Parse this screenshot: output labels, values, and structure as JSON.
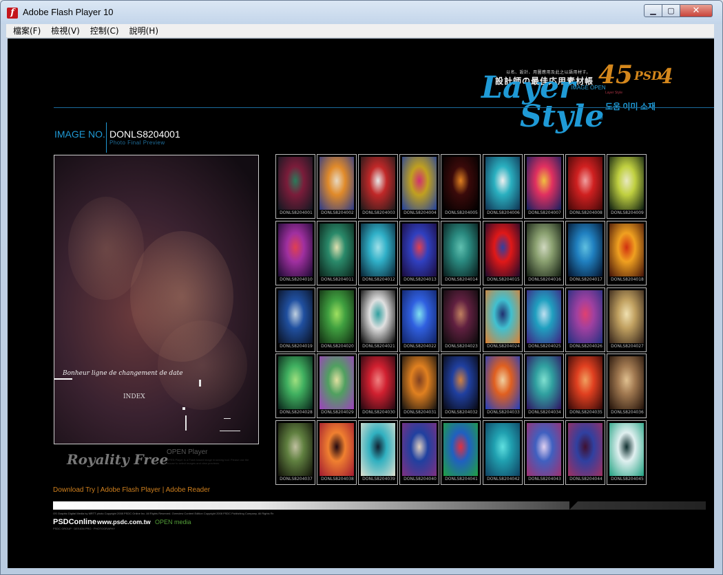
{
  "window": {
    "title": "Adobe Flash Player 10"
  },
  "window_controls": {
    "minimize": "▁",
    "maximize": "▢",
    "close": "✕"
  },
  "menu": [
    {
      "label": "檔案(F)"
    },
    {
      "label": "檢視(V)"
    },
    {
      "label": "控制(C)"
    },
    {
      "label": "說明(H)"
    }
  ],
  "logo": {
    "small_text": "以名、設計、用圖應用及此之以語用材す。",
    "cn_title": "設計師の最佳応用素材帳",
    "number": "45",
    "psd": "PSD",
    "version": "4",
    "image_open": "IMAGE OPEN",
    "word1": "Layer",
    "word2": "Style",
    "tm": "TM",
    "korean": "도움 이미 소재",
    "tiny": "Layer Style",
    "accent_color": "#1f9ad6",
    "orange_color": "#d4871c"
  },
  "image_info": {
    "label": "IMAGE NO.",
    "value": "DONLS8204001",
    "sub": "Photo Final Preview"
  },
  "preview": {
    "caption": "Bonheur ligne de changement de date",
    "index": "INDEX"
  },
  "royalty": {
    "label": "Royality Free",
    "open_player": "OPEN Player",
    "open_player_sub": "OPEN Player is a Flash based image browsing tool. Please use the mouse to select images and view previews."
  },
  "thumbnails": [
    {
      "code": "DONLS8204001",
      "c1": "#7a1c3a",
      "c2": "#101820",
      "c3": "#2a7a5a"
    },
    {
      "code": "DONLS8204002",
      "c1": "#e08a2a",
      "c2": "#2a3a8a",
      "c3": "#e8d8c0"
    },
    {
      "code": "DONLS8204003",
      "c1": "#c02828",
      "c2": "#1a1a1a",
      "c3": "#e8e8e8"
    },
    {
      "code": "DONLS8204004",
      "c1": "#c0a020",
      "c2": "#2040a0",
      "c3": "#d03070"
    },
    {
      "code": "DONLS8204005",
      "c1": "#3a0a0a",
      "c2": "#000000",
      "c3": "#e08020"
    },
    {
      "code": "DONLS8204006",
      "c1": "#2ab0c0",
      "c2": "#103050",
      "c3": "#f0f0f0"
    },
    {
      "code": "DONLS8204007",
      "c1": "#e03060",
      "c2": "#102060",
      "c3": "#f0c040"
    },
    {
      "code": "DONLS8204008",
      "c1": "#d02020",
      "c2": "#400808",
      "c3": "#f0a0a0"
    },
    {
      "code": "DONLS8204009",
      "c1": "#c0d040",
      "c2": "#0a1a10",
      "c3": "#e8e8c0"
    },
    {
      "code": "DONLS8204010",
      "c1": "#a030a0",
      "c2": "#1a0a30",
      "c3": "#e04050"
    },
    {
      "code": "DONLS8204011",
      "c1": "#2a8a6a",
      "c2": "#0a2018",
      "c3": "#e0e0b0"
    },
    {
      "code": "DONLS8204012",
      "c1": "#30b0c8",
      "c2": "#082030",
      "c3": "#a0e0e8"
    },
    {
      "code": "DONLS8204013",
      "c1": "#3040c0",
      "c2": "#1a0a3a",
      "c3": "#e04050"
    },
    {
      "code": "DONLS8204014",
      "c1": "#2a8a80",
      "c2": "#081818",
      "c3": "#60c0b0"
    },
    {
      "code": "DONLS8204015",
      "c1": "#e01818",
      "c2": "#1a0a2a",
      "c3": "#3040a0"
    },
    {
      "code": "DONLS8204016",
      "c1": "#8aa070",
      "c2": "#101a10",
      "c3": "#d0d8c0"
    },
    {
      "code": "DONLS8204017",
      "c1": "#2080c0",
      "c2": "#041028",
      "c3": "#60c0e0"
    },
    {
      "code": "DONLS8204018",
      "c1": "#f0a020",
      "c2": "#401008",
      "c3": "#d03010"
    },
    {
      "code": "DONLS8204019",
      "c1": "#2050a0",
      "c2": "#0a1020",
      "c3": "#c0d0e0"
    },
    {
      "code": "DONLS8204020",
      "c1": "#40a040",
      "c2": "#102a10",
      "c3": "#a0e060"
    },
    {
      "code": "DONLS8204021",
      "c1": "#e0e0e0",
      "c2": "#000000",
      "c3": "#30a0a0"
    },
    {
      "code": "DONLS8204022",
      "c1": "#3060e0",
      "c2": "#102060",
      "c3": "#80e0f0"
    },
    {
      "code": "DONLS8204023",
      "c1": "#602040",
      "c2": "#0a0a0a",
      "c3": "#c08060"
    },
    {
      "code": "DONLS8204024",
      "c1": "#40c0d0",
      "c2": "#e08030",
      "c3": "#203070"
    },
    {
      "code": "DONLS8204025",
      "c1": "#20a0c0",
      "c2": "#402080",
      "c3": "#c0e0f0"
    },
    {
      "code": "DONLS8204026",
      "c1": "#a040a0",
      "c2": "#203080",
      "c3": "#e04070"
    },
    {
      "code": "DONLS8204027",
      "c1": "#c0a060",
      "c2": "#302018",
      "c3": "#f0e0b0"
    },
    {
      "code": "DONLS8204028",
      "c1": "#40b060",
      "c2": "#082018",
      "c3": "#a0e080"
    },
    {
      "code": "DONLS8204029",
      "c1": "#50a060",
      "c2": "#a040c0",
      "c3": "#e0e0a0"
    },
    {
      "code": "DONLS8204030",
      "c1": "#d02030",
      "c2": "#200810",
      "c3": "#f08080"
    },
    {
      "code": "DONLS8204031",
      "c1": "#e08020",
      "c2": "#101010",
      "c3": "#804020"
    },
    {
      "code": "DONLS8204032",
      "c1": "#2040a0",
      "c2": "#080810",
      "c3": "#d08040"
    },
    {
      "code": "DONLS8204033",
      "c1": "#e06020",
      "c2": "#2040c0",
      "c3": "#f0d0a0"
    },
    {
      "code": "DONLS8204034",
      "c1": "#30a0a0",
      "c2": "#301060",
      "c3": "#80e0d0"
    },
    {
      "code": "DONLS8204035",
      "c1": "#e04020",
      "c2": "#300808",
      "c3": "#f0a060"
    },
    {
      "code": "DONLS8204036",
      "c1": "#a07850",
      "c2": "#201008",
      "c3": "#e0c090"
    },
    {
      "code": "DONLS8204037",
      "c1": "#608040",
      "c2": "#101008",
      "c3": "#c0c0a0"
    },
    {
      "code": "DONLS8204038",
      "c1": "#f08030",
      "c2": "#a01830",
      "c3": "#200810"
    },
    {
      "code": "DONLS8204039",
      "c1": "#30b0c0",
      "c2": "#e0e0d0",
      "c3": "#102030"
    },
    {
      "code": "DONLS8204040",
      "c1": "#2040a0",
      "c2": "#803080",
      "c3": "#e0d0c0"
    },
    {
      "code": "DONLS8204041",
      "c1": "#2060c0",
      "c2": "#20a040",
      "c3": "#e03040"
    },
    {
      "code": "DONLS8204042",
      "c1": "#20a0b0",
      "c2": "#104060",
      "c3": "#60e0e0"
    },
    {
      "code": "DONLS8204043",
      "c1": "#4060c0",
      "c2": "#a03070",
      "c3": "#e0d0f0"
    },
    {
      "code": "DONLS8204044",
      "c1": "#3040a0",
      "c2": "#a03060",
      "c3": "#401030"
    },
    {
      "code": "DONLS8204045",
      "c1": "#e0f0f0",
      "c2": "#20a080",
      "c3": "#103030"
    }
  ],
  "footer": {
    "download_links": "Download Try | Adobe Flash Player | Adobe Reader",
    "copyright": "OS Graphic Digital Media by MRTT photo Copyright 2008 PSDC Online Inc. All Rights Reserved. Overview Content Edition Copyright 2008 PSDC Publishing Company. All Rights Reserved.",
    "psdc_logo": "PSDConline",
    "psdc_url": "www.psdc.com.tw",
    "open_media": "OPEN media",
    "psdc_sub": "PSDC GROUP · DESIGN PRO · PHOTOGRAPHY"
  }
}
